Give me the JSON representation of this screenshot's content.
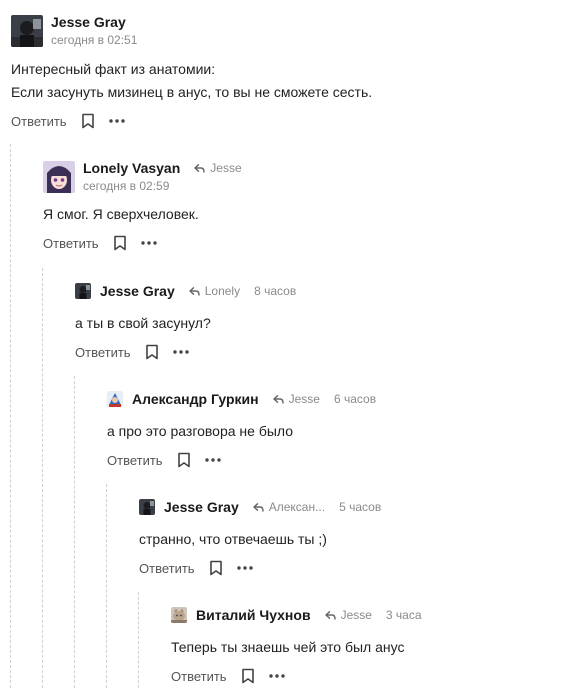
{
  "comments": [
    {
      "author": "Jesse Gray",
      "time": "сегодня в 02:51",
      "reply_to": "",
      "text_lines": [
        "Интересный факт из анатомии:",
        "Если засунуть мизинец в анус, то вы не сможете сесть."
      ],
      "reply_label": "Ответить",
      "avatar_icon": "dark-character-avatar"
    },
    {
      "author": "Lonely Vasyan",
      "time": "сегодня в 02:59",
      "reply_to": "Jesse",
      "text_lines": [
        "Я смог. Я сверхчеловек."
      ],
      "reply_label": "Ответить",
      "avatar_icon": "anime-girl-avatar"
    },
    {
      "author": "Jesse Gray",
      "time": "8 часов",
      "reply_to": "Lonely",
      "text_lines": [
        "а ты в свой засунул?"
      ],
      "reply_label": "Ответить",
      "avatar_icon": "dark-character-avatar"
    },
    {
      "author": "Александр Гуркин",
      "time": "6 часов",
      "reply_to": "Jesse",
      "text_lines": [
        "а про это разговора не было"
      ],
      "reply_label": "Ответить",
      "avatar_icon": "blue-character-avatar"
    },
    {
      "author": "Jesse Gray",
      "time": "5 часов",
      "reply_to": "Алексан...",
      "text_lines": [
        "странно, что отвечаешь ты ;)"
      ],
      "reply_label": "Ответить",
      "avatar_icon": "dark-character-avatar"
    },
    {
      "author": "Виталий Чухнов",
      "time": "3 часа",
      "reply_to": "Jesse",
      "text_lines": [
        "Теперь ты знаешь чей это был анус"
      ],
      "reply_label": "Ответить",
      "avatar_icon": "cat-photo-avatar"
    }
  ],
  "colors": {
    "text": "#222222",
    "meta": "#8a8a8a",
    "thread_line": "#d0d0d0"
  }
}
